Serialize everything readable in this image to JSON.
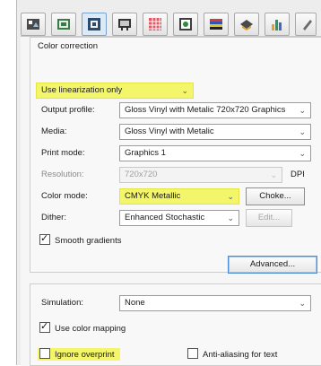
{
  "toolbar": {
    "buttons": [
      {
        "icon": "settings-page-icon"
      },
      {
        "icon": "media-page-icon"
      },
      {
        "icon": "color-page-icon",
        "selected": true
      },
      {
        "icon": "layout-page-icon"
      },
      {
        "icon": "grid-page-icon"
      },
      {
        "icon": "image-page-icon"
      },
      {
        "icon": "swatch-page-icon"
      },
      {
        "icon": "output-page-icon"
      },
      {
        "icon": "chart-page-icon"
      }
    ]
  },
  "color_correction": {
    "group_title": "Color correction",
    "mode_value": "Use linearization only",
    "rows": {
      "output_profile": {
        "label": "Output profile:",
        "value": "Gloss Vinyl with Metalic 720x720 Graphics"
      },
      "media": {
        "label": "Media:",
        "value": "Gloss Vinyl with Metalic"
      },
      "print_mode": {
        "label": "Print mode:",
        "value": "Graphics 1"
      },
      "resolution": {
        "label": "Resolution:",
        "value": "720x720",
        "unit": "DPI"
      },
      "color_mode": {
        "label": "Color mode:",
        "value": "CMYK Metallic",
        "button": "Choke..."
      },
      "dither": {
        "label": "Dither:",
        "value": "Enhanced Stochastic",
        "button": "Edit..."
      }
    },
    "smooth_gradients": {
      "label": "Smooth gradients",
      "checked": true
    },
    "advanced_button": "Advanced..."
  },
  "simulation": {
    "label": "Simulation:",
    "value": "None",
    "use_color_mapping": {
      "label": "Use color mapping",
      "checked": true
    },
    "ignore_overprint": {
      "label": "Ignore overprint",
      "checked": false
    },
    "anti_aliasing": {
      "label": "Anti-aliasing for text",
      "checked": false
    }
  },
  "colors": {
    "highlight": "#f3f56a",
    "selected_tab": "#dce9f7"
  }
}
